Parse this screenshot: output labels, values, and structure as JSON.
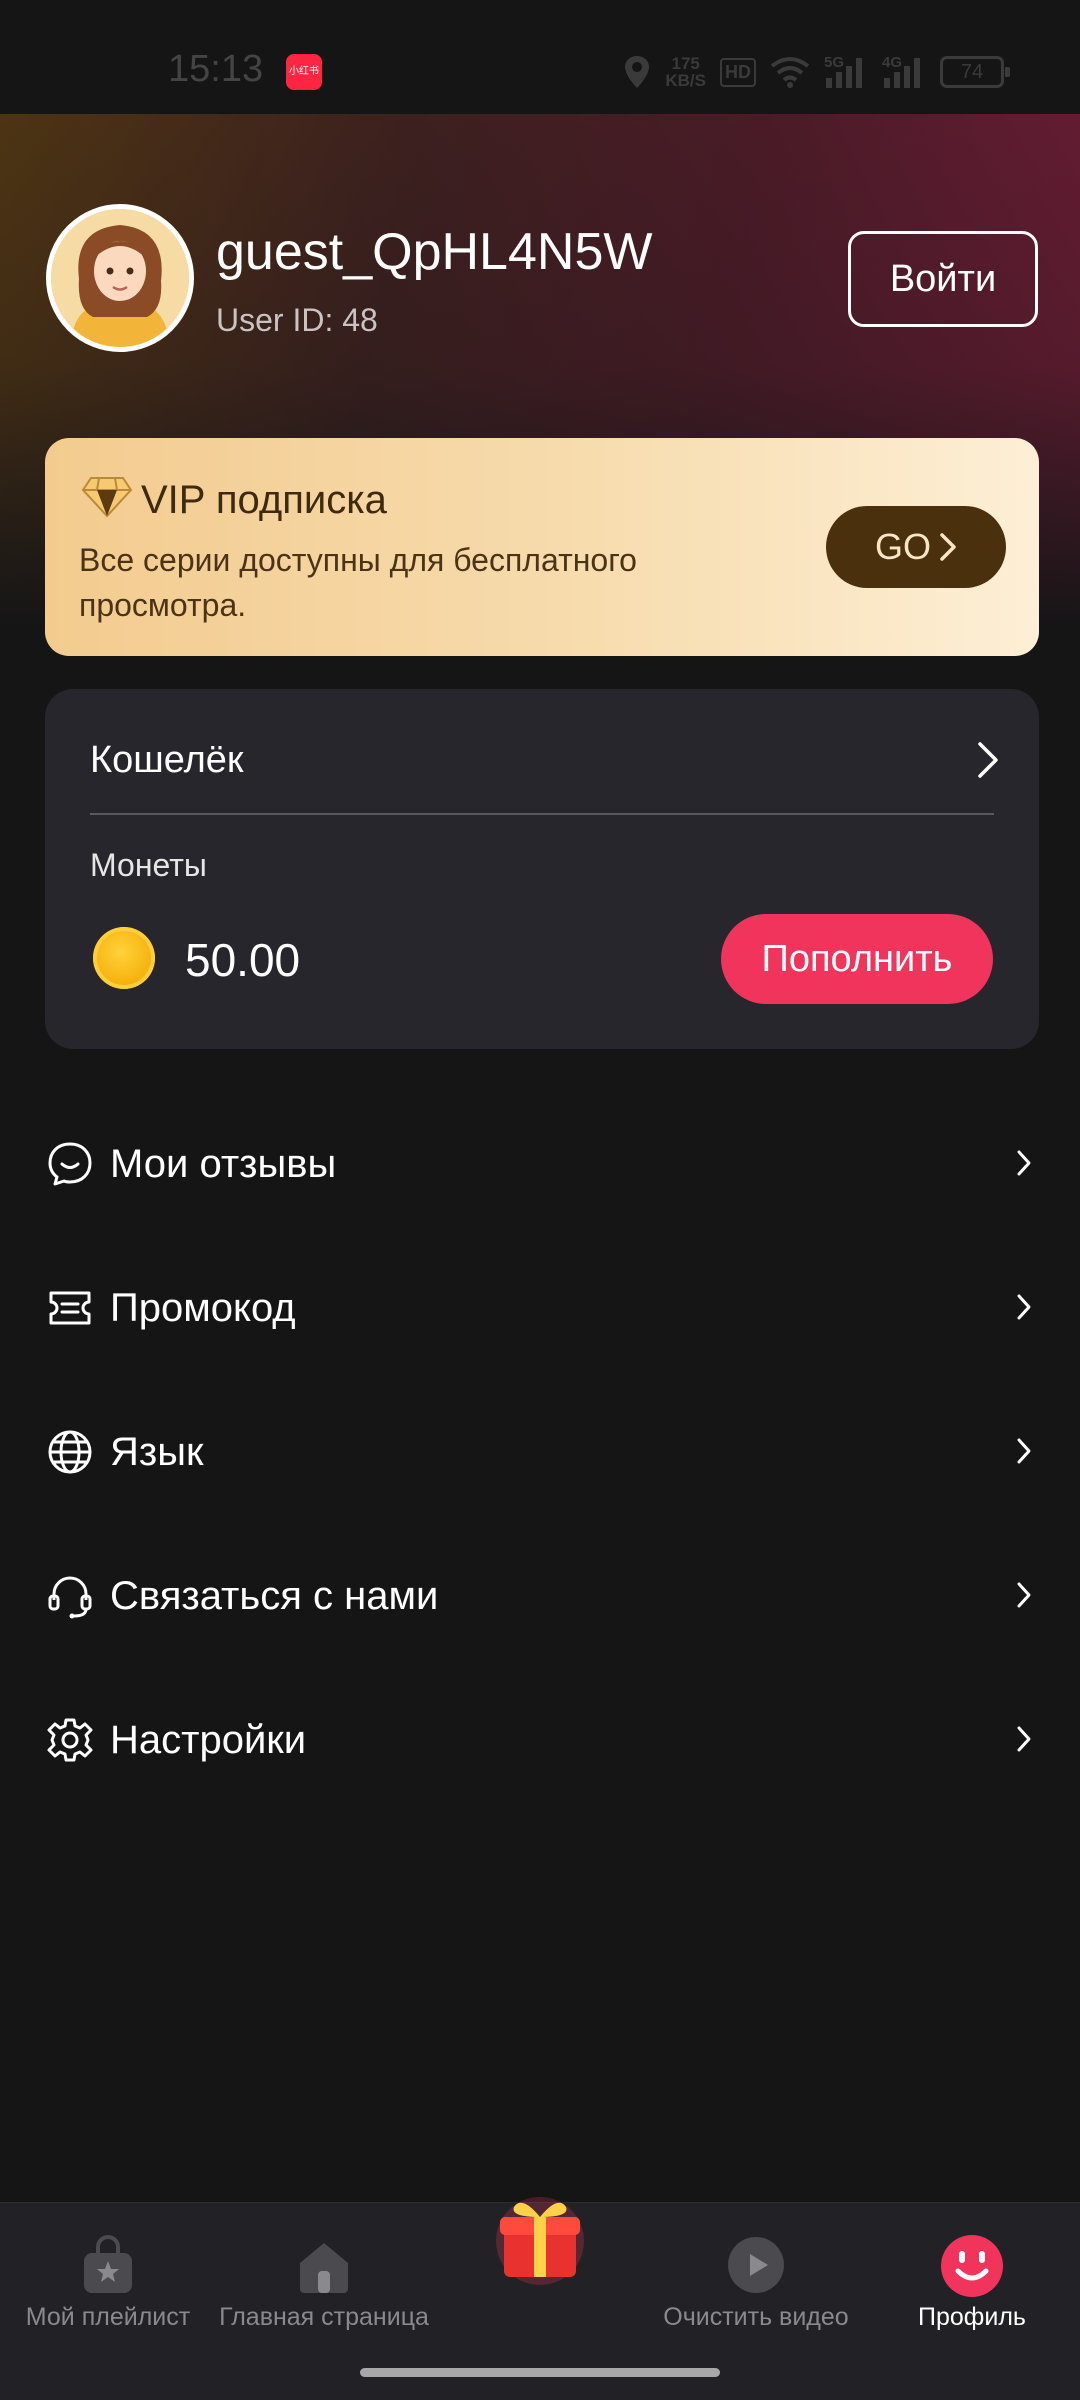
{
  "status_bar": {
    "time": "15:13",
    "app_badge": "小红书",
    "net_speed_value": "175",
    "net_speed_unit": "KB/S",
    "hd_label": "HD",
    "signal_1_label": "5G",
    "signal_2_label": "4G",
    "battery": "74"
  },
  "profile": {
    "username": "guest_QpHL4N5W",
    "user_id": "User ID: 48",
    "login_label": "Войти"
  },
  "vip": {
    "title": "VIP подписка",
    "description": "Все серии доступны для бесплатного просмотра.",
    "go_label": "GO"
  },
  "wallet": {
    "title": "Кошелёк",
    "coins_label": "Монеты",
    "coins_amount": "50.00",
    "topup_label": "Пополнить"
  },
  "menu": {
    "items": [
      {
        "label": "Мои отзывы",
        "icon": "chat-smile-icon"
      },
      {
        "label": "Промокод",
        "icon": "ticket-icon"
      },
      {
        "label": "Язык",
        "icon": "globe-icon"
      },
      {
        "label": "Связаться с нами",
        "icon": "headset-icon"
      },
      {
        "label": "Настройки",
        "icon": "gear-icon"
      }
    ]
  },
  "bottom_nav": {
    "items": [
      {
        "label": "Мой плейлист",
        "icon": "playlist-bag-icon"
      },
      {
        "label": "Главная страница",
        "icon": "home-icon"
      },
      {
        "label": "",
        "icon": "gift-icon"
      },
      {
        "label": "Очистить видео",
        "icon": "play-icon"
      },
      {
        "label": "Профиль",
        "icon": "profile-smile-icon",
        "active": true
      }
    ]
  },
  "colors": {
    "background": "#151516",
    "accent_pink": "#f0345c",
    "vip_gold": "#f3cb8f",
    "vip_button": "#4a300c",
    "card": "#27262c"
  }
}
